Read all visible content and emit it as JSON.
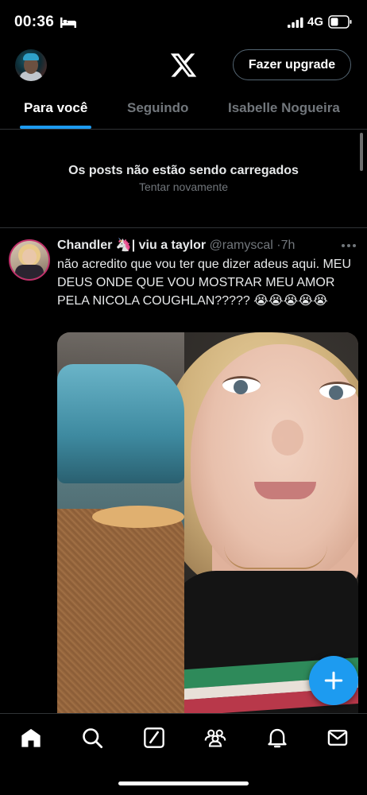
{
  "status_bar": {
    "time": "00:36",
    "network": "4G",
    "icons": [
      "bed-icon",
      "signal-icon",
      "battery-icon"
    ]
  },
  "top_nav": {
    "logo": "x-logo-icon",
    "upgrade_label": "Fazer upgrade"
  },
  "tabs": [
    {
      "label": "Para você",
      "active": true
    },
    {
      "label": "Seguindo",
      "active": false
    },
    {
      "label": "Isabelle Nogueira",
      "active": false
    }
  ],
  "error_banner": {
    "title": "Os posts não estão sendo carregados",
    "retry": "Tentar novamente"
  },
  "tweet": {
    "name": "Chandler 🦄| viu a taylor",
    "handle": "@ramyscal",
    "time": "7h",
    "separator": "·",
    "text": "não acredito que vou ter que dizer adeus aqui. MEU DEUS ONDE QUE VOU MOSTRAR MEU AMOR PELA NICOLA COUGHLAN????? 😭😭😭😭😭"
  },
  "fab": {
    "icon": "plus-icon"
  },
  "bottom_nav": {
    "items": [
      "home-icon",
      "search-icon",
      "grok-icon",
      "communities-icon",
      "notifications-icon",
      "messages-icon"
    ]
  },
  "colors": {
    "accent": "#1d9bf0",
    "background": "#000000",
    "muted_text": "#71767b",
    "divider": "#2f3336"
  }
}
